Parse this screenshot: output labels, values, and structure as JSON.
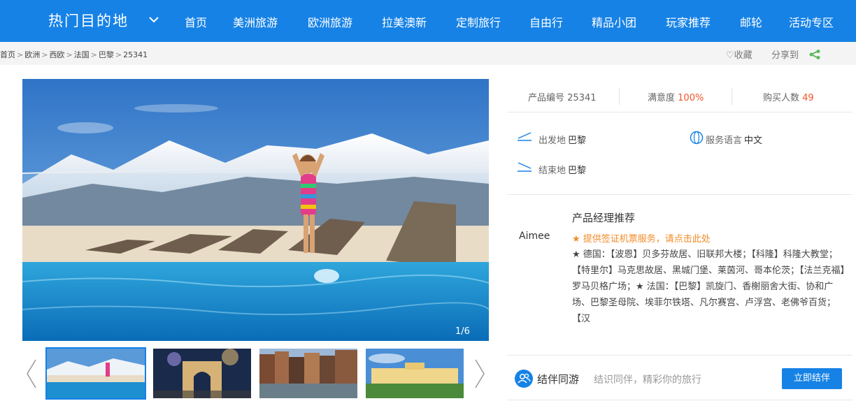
{
  "nav": {
    "hot_destinations": "热门目的地",
    "items": [
      "首页",
      "美洲旅游",
      "欧洲旅游",
      "拉美澳新",
      "定制旅行",
      "自由行",
      "精品小团",
      "玩家推荐",
      "邮轮",
      "活动专区"
    ]
  },
  "breadcrumb": {
    "items": [
      "首页",
      "欧洲",
      "西欧",
      "法国",
      "巴黎",
      "25341"
    ],
    "separator": ">"
  },
  "actions": {
    "favorite": "♡收藏",
    "share": "分享到"
  },
  "gallery": {
    "counter": "1/6",
    "thumbnail_alts": [
      "泳池",
      "凯旋门",
      "运河建筑",
      "宫殿"
    ]
  },
  "product": {
    "code_label": "产品编号",
    "code": "25341",
    "satisfaction_label": "满意度",
    "satisfaction": "100%",
    "buyers_label": "购买人数",
    "buyers": "49",
    "departure_label": "出发地",
    "departure": "巴黎",
    "language_label": "服务语言",
    "language": "中文",
    "end_label": "结束地",
    "end": "巴黎"
  },
  "manager": {
    "title": "产品经理推荐",
    "name": "Aimee",
    "link": "★ 提供签证机票服务，请点击此处",
    "text": "★ 德国：【波恩】贝多芬故居、旧联邦大楼；【科隆】科隆大教堂；【特里尔】马克思故居、黑城门堡、莱茵河、哥本伦茨；【法兰克福】罗马贝格广场；★ 法国：【巴黎】凯旋门、香榭丽舍大街、协和广场、巴黎圣母院、埃菲尔铁塔、凡尔赛宫、卢浮宫、老佛爷百货；【汉"
  },
  "companion": {
    "title": "结伴同游",
    "desc": "结识同伴，精彩你的旅行",
    "button": "立即结伴"
  },
  "colors": {
    "brand": "#1682e6",
    "highlight": "#f0552a",
    "orange_link": "#f38a26"
  }
}
